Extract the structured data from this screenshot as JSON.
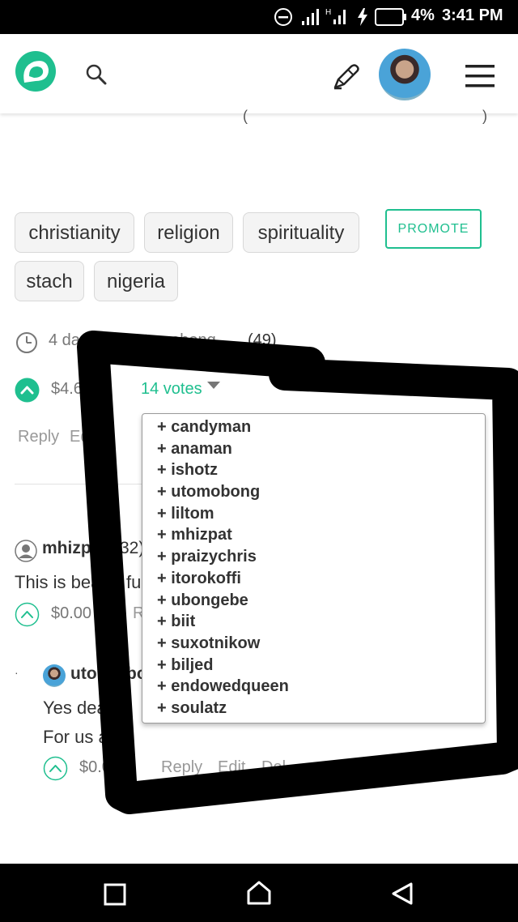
{
  "status_bar": {
    "battery": "4%",
    "time": "3:41 PM"
  },
  "tags": [
    "christianity",
    "religion",
    "spirituality",
    "stach",
    "nigeria"
  ],
  "promote_label": "PROMOTE",
  "post_meta": {
    "time_partial": "4 da",
    "author_partial": "by utomobong",
    "reputation": "(49)"
  },
  "payout": {
    "amount_partial": "$4.6",
    "votes_label": "14 votes"
  },
  "post_actions": {
    "reply": "Reply",
    "edit_partial": "Ed"
  },
  "voters": [
    "+ candyman",
    "+ anaman",
    "+ ishotz",
    "+ utomobong",
    "+ liltom",
    "+ mhizpat",
    "+ praizychris",
    "+ itorokoffi",
    "+ ubongebe",
    "+ biit",
    "+ suxotnikow",
    "+ biljed",
    "+ endowedqueen",
    "+ soulatz"
  ],
  "comment1": {
    "author_partial": "mhizp",
    "rep_partial": "32)",
    "text_partial": "This is bea",
    "text_partial2": "fu",
    "payout": "$0.00",
    "reply_partial": "R"
  },
  "comment2": {
    "author_partial": "utor",
    "author_partial2": "bo",
    "line1_partial": "Yes dea",
    "line2_partial": "For us a",
    "payout_partial": "$0.0",
    "reply": "Reply",
    "edit": "Edit",
    "delete_partial": "Del"
  },
  "colors": {
    "accent": "#1fbf8f",
    "status_bar": "#000000"
  }
}
